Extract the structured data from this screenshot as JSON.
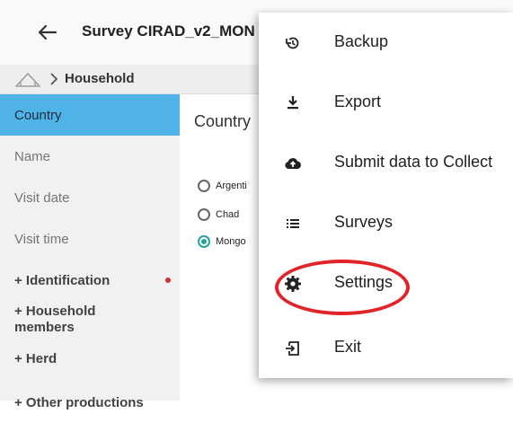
{
  "appbar": {
    "title": "Survey CIRAD_v2_MON"
  },
  "breadcrumb": {
    "current": "Household"
  },
  "sidebar": {
    "items": [
      {
        "label": "Country"
      },
      {
        "label": "Name"
      },
      {
        "label": "Visit date"
      },
      {
        "label": "Visit time"
      },
      {
        "label": "+ Identification"
      },
      {
        "label": "+ Household members"
      },
      {
        "label": "+ Herd"
      },
      {
        "label": "+ Other productions"
      }
    ]
  },
  "main": {
    "field_title": "Country",
    "options": [
      {
        "label": "Argenti",
        "selected": false
      },
      {
        "label": "Chad",
        "selected": false
      },
      {
        "label": "Mongo",
        "selected": true
      }
    ]
  },
  "menu": {
    "items": [
      {
        "label": "Backup",
        "icon": "backup-icon"
      },
      {
        "label": "Export",
        "icon": "download-icon"
      },
      {
        "label": "Submit data to Collect",
        "icon": "cloud-upload-icon"
      },
      {
        "label": "Surveys",
        "icon": "list-icon"
      },
      {
        "label": "Settings",
        "icon": "gear-icon"
      },
      {
        "label": "Exit",
        "icon": "exit-icon"
      }
    ]
  },
  "colors": {
    "active_item": "#4fb3e8",
    "radio_selected": "#26a69a",
    "required_dot": "#d32f2f",
    "highlight": "#e2232a"
  }
}
